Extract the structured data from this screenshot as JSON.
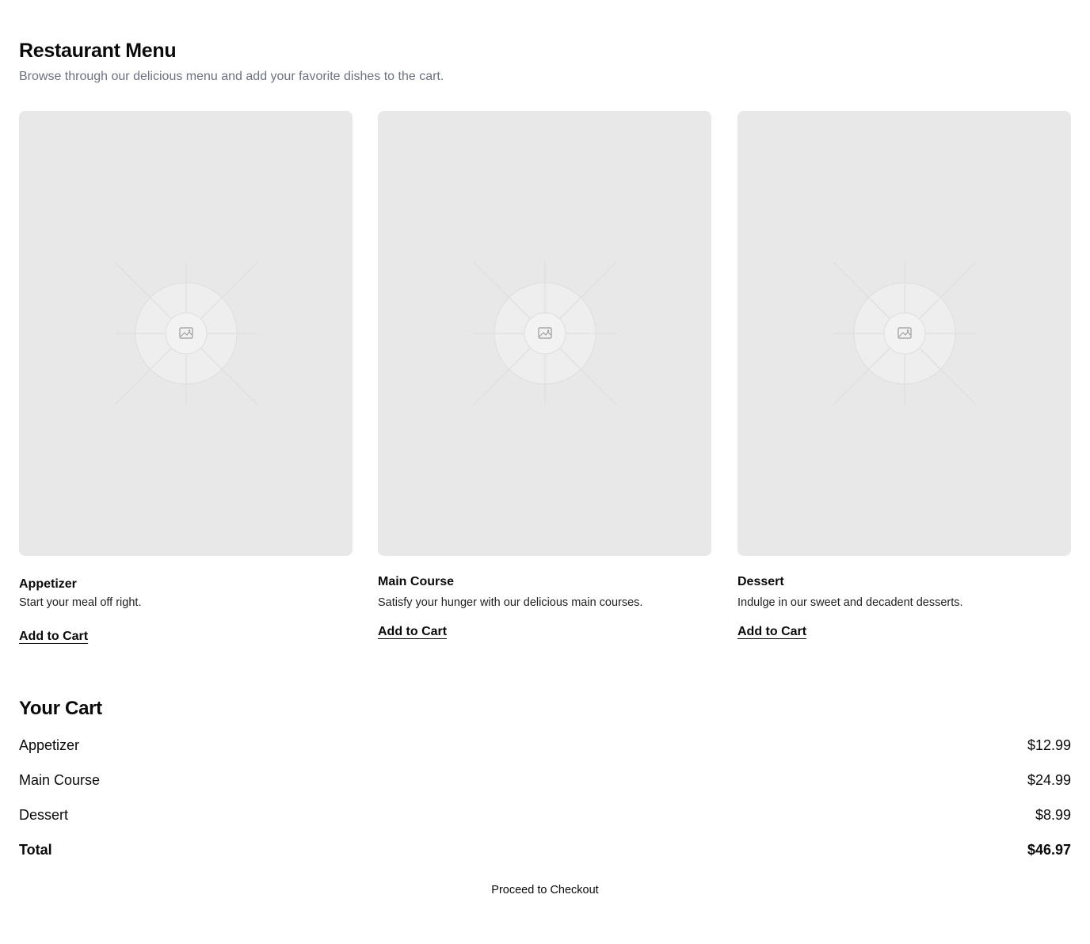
{
  "header": {
    "title": "Restaurant Menu",
    "subtitle": "Browse through our delicious menu and add your favorite dishes to the cart."
  },
  "menu": {
    "items": [
      {
        "title": "Appetizer",
        "description": "Start your meal off right.",
        "button_label": "Add to Cart",
        "image_icon": "image-placeholder-icon"
      },
      {
        "title": "Main Course",
        "description": "Satisfy your hunger with our delicious main courses.",
        "button_label": "Add to Cart",
        "image_icon": "image-placeholder-icon"
      },
      {
        "title": "Dessert",
        "description": "Indulge in our sweet and decadent desserts.",
        "button_label": "Add to Cart",
        "image_icon": "image-placeholder-icon"
      }
    ]
  },
  "cart": {
    "title": "Your Cart",
    "items": [
      {
        "name": "Appetizer",
        "price": "$12.99"
      },
      {
        "name": "Main Course",
        "price": "$24.99"
      },
      {
        "name": "Dessert",
        "price": "$8.99"
      }
    ],
    "total_label": "Total",
    "total_value": "$46.97",
    "checkout_label": "Proceed to Checkout"
  },
  "colors": {
    "image_background": "#e8e8e8",
    "subtitle_text": "#6b7280",
    "text": "#0a0a0a"
  }
}
